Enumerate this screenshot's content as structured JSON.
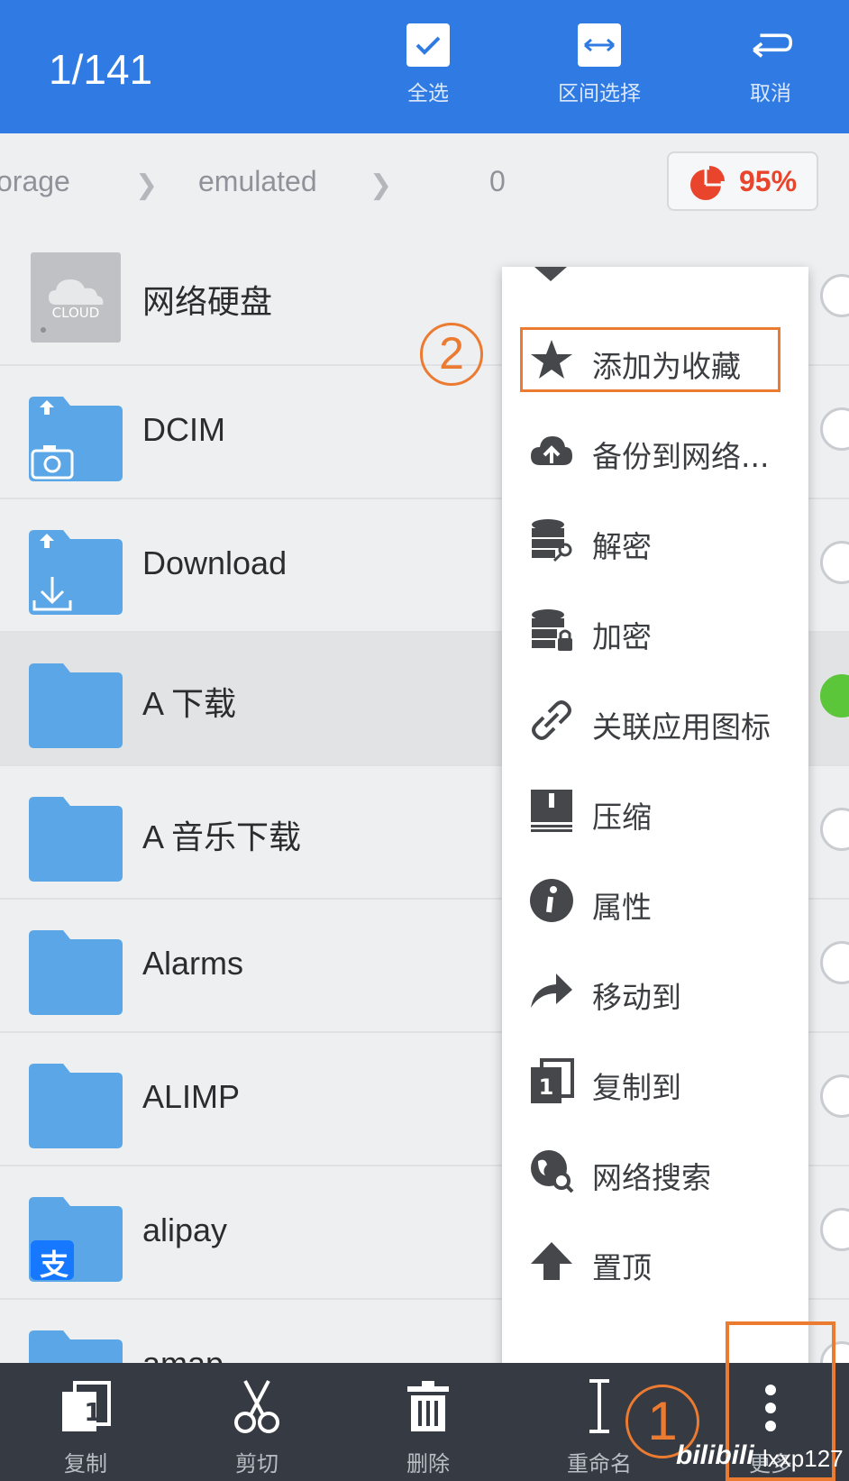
{
  "header": {
    "count": "1/141",
    "select_all": "全选",
    "range_select": "区间选择",
    "cancel": "取消",
    "bg_color": "#2f7be3"
  },
  "breadcrumb": {
    "items": [
      "orage",
      "emulated",
      "0"
    ],
    "storage_percent": "95%",
    "storage_color": "#e8452c"
  },
  "files": [
    {
      "name": "网络硬盘",
      "icon": "cloud-drive-icon",
      "cloud_label": "CLOUD",
      "selected": false
    },
    {
      "name": "DCIM",
      "icon": "camera-folder-icon",
      "selected": false
    },
    {
      "name": "Download",
      "icon": "download-folder-icon",
      "selected": false
    },
    {
      "name": "A 下载",
      "icon": "folder-icon",
      "selected": true
    },
    {
      "name": "A 音乐下载",
      "icon": "folder-icon",
      "selected": false
    },
    {
      "name": "Alarms",
      "icon": "folder-icon",
      "selected": false
    },
    {
      "name": "ALIMP",
      "icon": "folder-icon",
      "selected": false
    },
    {
      "name": "alipay",
      "icon": "alipay-folder-icon",
      "badge": "支",
      "selected": false
    },
    {
      "name": "amap",
      "icon": "folder-icon",
      "selected": false
    }
  ],
  "menu": {
    "items": [
      {
        "label": "添加为收藏",
        "icon": "star-icon"
      },
      {
        "label": "备份到网络...",
        "icon": "cloud-upload-icon"
      },
      {
        "label": "解密",
        "icon": "decrypt-icon"
      },
      {
        "label": "加密",
        "icon": "encrypt-icon"
      },
      {
        "label": "关联应用图标",
        "icon": "link-icon"
      },
      {
        "label": "压缩",
        "icon": "compress-icon"
      },
      {
        "label": "属性",
        "icon": "info-icon"
      },
      {
        "label": "移动到",
        "icon": "move-icon"
      },
      {
        "label": "复制到",
        "icon": "copy-to-icon",
        "glyph": "1"
      },
      {
        "label": "网络搜索",
        "icon": "web-search-icon"
      },
      {
        "label": "置顶",
        "icon": "pin-top-icon"
      }
    ],
    "highlight_color": "#ec7b32"
  },
  "annotations": {
    "step1": "1",
    "step2": "2"
  },
  "bottom_bar": {
    "copy": "复制",
    "copy_glyph": "1",
    "cut": "剪切",
    "delete": "删除",
    "rename": "重命名",
    "more": "更多"
  },
  "watermark": {
    "logo": "bilibili",
    "user": "lxxp127"
  }
}
